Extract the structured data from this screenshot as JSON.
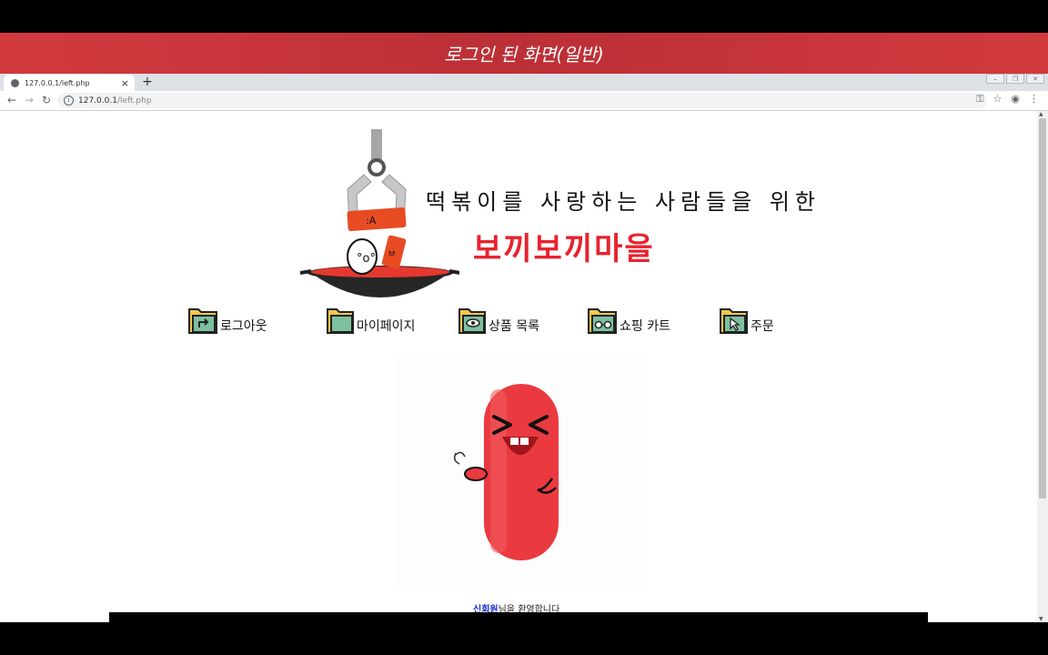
{
  "banner": {
    "caption": "로그인 된 화면(일반)"
  },
  "browser": {
    "tab_title": "127.0.0.1/left.php",
    "tab_close": "×",
    "new_tab": "+",
    "url_host": "127.0.0.1",
    "url_path": "/left.php",
    "nav": {
      "back": "←",
      "forward": "→",
      "reload": "↻"
    },
    "icons": [
      "key-icon",
      "star-icon",
      "account-icon",
      "menu-dots-icon"
    ]
  },
  "site": {
    "tagline": "떡볶이를 사랑하는 사람들을 위한",
    "brand": "보끼보끼마을",
    "brand_color": "#e8222e"
  },
  "menu": [
    {
      "label": "로그아웃",
      "icon": "folder-arrow-icon"
    },
    {
      "label": "마이페이지",
      "icon": "folder-icon"
    },
    {
      "label": "상품 목록",
      "icon": "folder-eye-icon"
    },
    {
      "label": "쇼핑 카트",
      "icon": "folder-glasses-icon"
    },
    {
      "label": "주문",
      "icon": "folder-cursor-icon"
    }
  ],
  "welcome": {
    "name": "신회원",
    "suffix": "님을 환영합니다"
  },
  "colors": {
    "banner": "#c9353b",
    "folder": "#f2c64e",
    "folder_inner": "#7cc0a0"
  }
}
